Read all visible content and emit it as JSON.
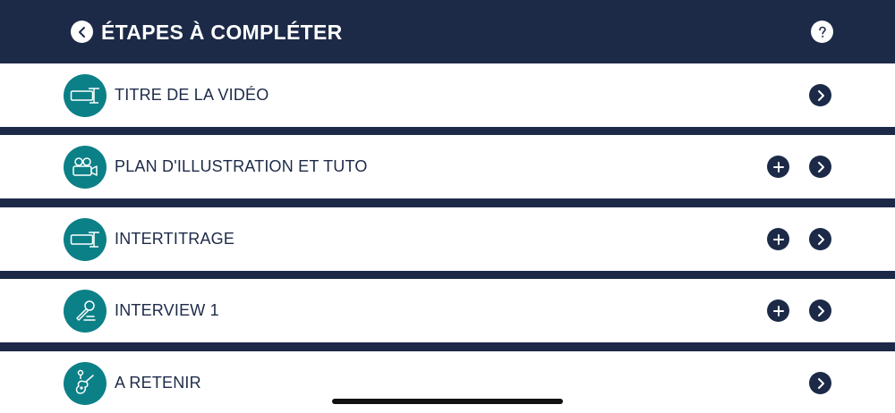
{
  "header": {
    "title": "ÉTAPES À COMPLÉTER",
    "back_icon": "chevron-left-icon",
    "help_icon": "question-icon"
  },
  "colors": {
    "navy": "#1c2a48",
    "teal": "#0c8087",
    "white": "#ffffff"
  },
  "steps": [
    {
      "label": "TITRE DE LA VIDÉO",
      "icon": "title-card-icon",
      "has_add": false
    },
    {
      "label": "PLAN D'ILLUSTRATION ET TUTO",
      "icon": "camera-icon",
      "has_add": true
    },
    {
      "label": "INTERTITRAGE",
      "icon": "title-card-icon",
      "has_add": true
    },
    {
      "label": "INTERVIEW 1",
      "icon": "microphone-icon",
      "has_add": true
    },
    {
      "label": "A RETENIR",
      "icon": "guitar-icon",
      "has_add": false
    }
  ]
}
